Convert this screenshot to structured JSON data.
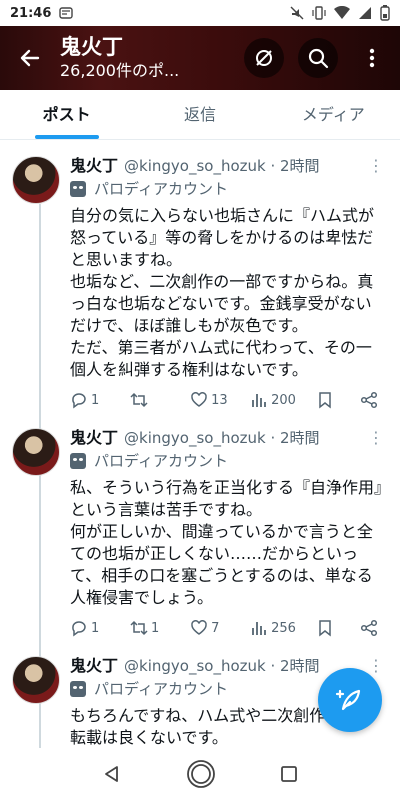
{
  "status": {
    "time": "21:46"
  },
  "header": {
    "name": "鬼火丁",
    "post_count": "26,200件のポ..."
  },
  "tabs": [
    {
      "label": "ポスト",
      "active": true
    },
    {
      "label": "返信",
      "active": false
    },
    {
      "label": "メディア",
      "active": false
    }
  ],
  "posts": [
    {
      "name": "鬼火丁",
      "handle": "@kingyo_so_hozuk · 2時間",
      "parody": "パロディアカウント",
      "lines": [
        "自分の気に入らない也垢さんに『ハム式が怒っている』等の脅しをかけるのは卑怯だと思いますね。",
        "也垢など、二次創作の一部ですからね。真っ白な也垢などないです。金銭享受がないだけで、ほぼ誰しもが灰色です。",
        "ただ、第三者がハム式に代わって、その一個人を糾弾する権利はないです。"
      ],
      "replies": "1",
      "reposts": "",
      "likes": "13",
      "views": "200"
    },
    {
      "name": "鬼火丁",
      "handle": "@kingyo_so_hozuk · 2時間",
      "parody": "パロディアカウント",
      "lines": [
        "私、そういう行為を正当化する『自浄作用』という言葉は苦手ですね。",
        "何が正しいか、間違っているかで言うと全ての也垢が正しくない……だからといって、相手の口を塞ごうとするのは、単なる人権侵害でしょう。"
      ],
      "replies": "1",
      "reposts": "1",
      "likes": "7",
      "views": "256"
    },
    {
      "name": "鬼火丁",
      "handle": "@kingyo_so_hozuk · 2時間",
      "parody": "パロディアカウント",
      "lines": [
        "もちろんですね、ハム式や二次創作の無断転載は良くないです。"
      ]
    }
  ],
  "colors": {
    "accent": "#1d9bf0",
    "header_bg": "#3b0c0c"
  }
}
